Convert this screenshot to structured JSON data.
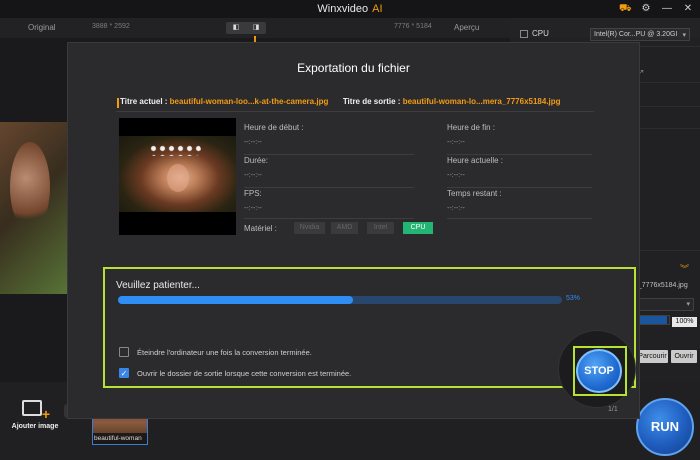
{
  "window": {
    "title": "Winxvideo",
    "title_accent": "AI",
    "accent_color": "#f39c12"
  },
  "top_bar": {
    "original_label": "Original",
    "original_res": "3888 * 2592",
    "output_res": "7776 * 5184",
    "preview_label": "Aperçu"
  },
  "right_panel": {
    "cpu_label": "CPU",
    "cpu_select": "Intel(R) Cor...PU @ 3.20GI",
    "output_filename": "a_7776x5184.jpg",
    "zoom_percent": "100%",
    "parcourir_label": "Parcourir",
    "ouvrir_label": "Ouvrir"
  },
  "bottom_bar": {
    "add_image_label": "Ajouter image",
    "thumbnail_caption": "beautiful-woman",
    "run_label": "RUN"
  },
  "modal": {
    "title": "Exportation du fichier",
    "current_title_key": "Titre actuel :",
    "current_title_value": "beautiful-woman-loo...k-at-the-camera.jpg",
    "output_title_key": "Titre de sortie :",
    "output_title_value": "beautiful-woman-lo...mera_7776x5184.jpg",
    "fields": {
      "start_time_label": "Heure de début :",
      "start_time_value": "--:--:--",
      "end_time_label": "Heure de fin :",
      "end_time_value": "--:--:--",
      "duration_label": "Durée:",
      "duration_value": "--:--:--",
      "current_time_label": "Heure actuelle :",
      "current_time_value": "--:--:--",
      "fps_label": "FPS:",
      "fps_value": "--:--:--",
      "remaining_label": "Temps restant :",
      "remaining_value": "--:--:--"
    },
    "hardware_label": "Matériel :",
    "hardware_options": [
      "Nvidia",
      "AMD",
      "Intel",
      "CPU"
    ],
    "hardware_selected": "CPU",
    "progress_label": "Veuillez patienter...",
    "progress_percent_text": "53%",
    "progress_fraction": 0.53,
    "shutdown_label": "Éteindre l'ordinateur une fois la conversion terminée.",
    "shutdown_checked": false,
    "open_folder_label": "Ouvrir le dossier de sortie lorsque cette conversion est terminée.",
    "open_folder_checked": true,
    "stop_label": "STOP",
    "page_count": "1/1"
  }
}
